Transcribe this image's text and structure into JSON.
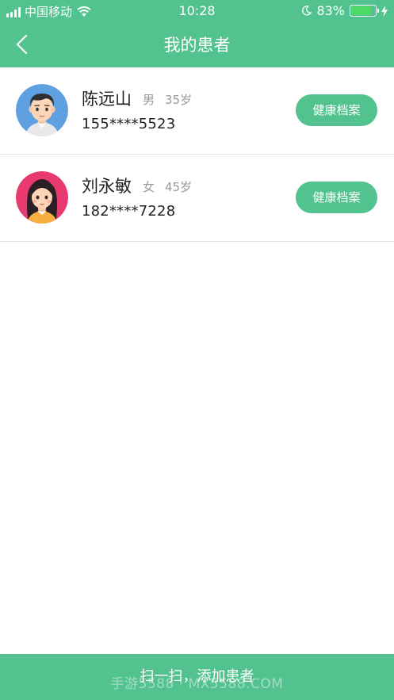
{
  "status_bar": {
    "carrier": "中国移动",
    "time": "10:28",
    "battery": "83%",
    "battery_level": 0.83
  },
  "header": {
    "title": "我的患者"
  },
  "patients": [
    {
      "name": "陈远山",
      "gender": "男",
      "age": "35岁",
      "phone": "155****5523",
      "action": "健康档案",
      "avatar": "male-avatar"
    },
    {
      "name": "刘永敏",
      "gender": "女",
      "age": "45岁",
      "phone": "182****7228",
      "action": "健康档案",
      "avatar": "female-avatar"
    }
  ],
  "footer": {
    "button_label": "扫一扫，添加患者",
    "watermark": "手游5588 · MX5588.COM"
  },
  "colors": {
    "accent": "#52c28f",
    "male_avatar_bg": "#5fa0e0",
    "female_avatar_bg": "#e83a6f"
  }
}
